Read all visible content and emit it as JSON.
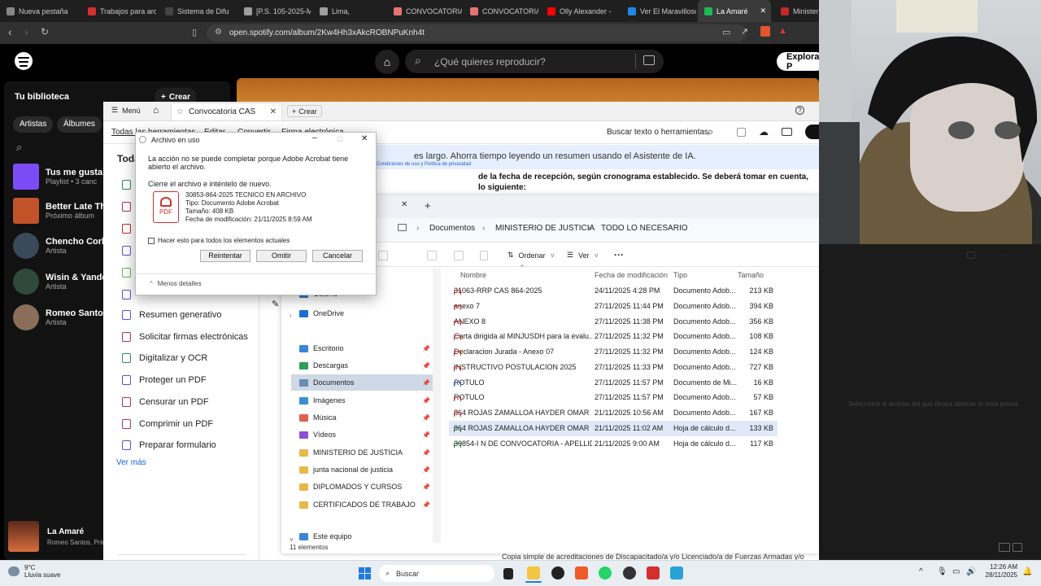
{
  "browser": {
    "tabs": [
      {
        "label": "Nueva pestaña",
        "color": "#888888"
      },
      {
        "label": "Trabajos para arc",
        "color": "#d32f2f"
      },
      {
        "label": "Sistema de Difu",
        "color": "#444444"
      },
      {
        "label": "[P.S. 105-2025-M",
        "color": "#9e9e9e"
      },
      {
        "label": "Lima,",
        "color": "#9e9e9e"
      },
      {
        "label": "CONVOCATORIA -",
        "color": "#e57373"
      },
      {
        "label": "CONVOCATORIA",
        "color": "#e57373"
      },
      {
        "label": "Olly Alexander -",
        "color": "#ff0000"
      },
      {
        "label": "Ver El Maravillosc",
        "color": "#1e88e5"
      },
      {
        "label": "La Amaré",
        "color": "#1db954",
        "active": true
      },
      {
        "label": "Ministeri",
        "color": "#c62828"
      }
    ],
    "url": "open.spotify.com/album/2Kw4Hh3xAkcROBNPuKnh4t"
  },
  "spotify": {
    "search_placeholder": "¿Qué quieres reproducir?",
    "explore_label": "Explorar P",
    "library_title": "Tu biblioteca",
    "create_label": "Crear",
    "filters": [
      "Artistas",
      "Álbumes"
    ],
    "items": [
      {
        "title": "Tus me gusta",
        "sub": "Playlist • 3 canc",
        "color": "#7b4cf5"
      },
      {
        "title": "Better Late Tha",
        "sub": "Próximo álbum",
        "color": "#c2522a"
      },
      {
        "title": "Chencho Corle",
        "sub": "Artista",
        "color": "#3b4a5a"
      },
      {
        "title": "Wisin & Yandel",
        "sub": "Artista",
        "color": "#2f4a3a"
      },
      {
        "title": "Romeo Santos",
        "sub": "Artista",
        "color": "#8a6e5a"
      }
    ],
    "now_playing": {
      "title": "La Amaré",
      "artist": "Romeo Santos, Prin"
    }
  },
  "acrobat": {
    "menu_label": "Menú",
    "tab_title": "Convocatoria CAS",
    "create_label": "Crear",
    "toolbar_tabs": [
      "Todas las herramientas",
      "Editar",
      "Convertir",
      "Firma electrónica"
    ],
    "search_tools": "Buscar texto o herramientas",
    "left_heading": "Toda",
    "tools": [
      "Resumen generativo",
      "Solicitar firmas electrónicas",
      "Digitalizar y OCR",
      "Proteger un PDF",
      "Censurar un PDF",
      "Comprimir un PDF",
      "Preparar formulario"
    ],
    "more_label": "Ver más",
    "ai_banner": "es largo. Ahorra tiempo leyendo un resumen usando el Asistente de IA.",
    "ai_links": "Condiciones de uso  y  Política de privacidad",
    "doc_text": "de la fecha de recepción, según cronograma establecido. Se deberá tomar en cuenta, lo siguiente:",
    "doc_bottom": "Copia simple de acreditaciones de Discapacitado/a y/o Licenciado/a de Fuerzas Armadas y/o"
  },
  "explorer": {
    "breadcrumb": [
      "Documentos",
      "MINISTERIO DE JUSTICIA",
      "TODO LO NECESARIO"
    ],
    "cmd": {
      "sort": "Ordenar",
      "view": "Ver",
      "preview": "Vista previa"
    },
    "nav": [
      {
        "label": "Galería",
        "color": "#2b7fd9",
        "pin": false
      },
      {
        "label": "OneDrive",
        "color": "#1e6fd1",
        "pin": false
      },
      {
        "label": "Escritorio",
        "color": "#3a86d4",
        "pin": true
      },
      {
        "label": "Descargas",
        "color": "#2e9e5b",
        "pin": true
      },
      {
        "label": "Documentos",
        "color": "#6a8caf",
        "pin": true,
        "selected": true
      },
      {
        "label": "Imágenes",
        "color": "#3b8fd6",
        "pin": true
      },
      {
        "label": "Música",
        "color": "#e0604f",
        "pin": true
      },
      {
        "label": "Vídeos",
        "color": "#8c4fd6",
        "pin": true
      },
      {
        "label": "MINISTERIO DE JUSTICIA",
        "color": "#e8b84a",
        "pin": true
      },
      {
        "label": "junta nacional de justicia",
        "color": "#e8b84a",
        "pin": true
      },
      {
        "label": "DIPLOMADOS Y CURSOS",
        "color": "#e8b84a",
        "pin": true
      },
      {
        "label": "CERTIFICADOS DE TRABAJO",
        "color": "#e8b84a",
        "pin": true
      },
      {
        "label": "Este equipo",
        "color": "#3a86d4",
        "pin": false
      }
    ],
    "columns": [
      "Nombre",
      "Fecha de modificación",
      "Tipo",
      "Tamaño"
    ],
    "files": [
      {
        "name": "31063-RRP CAS 864-2025",
        "date": "24/11/2025 4:28 PM",
        "type": "Documento Adob...",
        "size": "213 KB",
        "kind": "pdf"
      },
      {
        "name": "anexo 7",
        "date": "27/11/2025 11:44 PM",
        "type": "Documento Adob...",
        "size": "394 KB",
        "kind": "pdf"
      },
      {
        "name": "ANEXO 8",
        "date": "27/11/2025 11:38 PM",
        "type": "Documento Adob...",
        "size": "356 KB",
        "kind": "pdf"
      },
      {
        "name": "Carta dirigida al MINJUSDH para la evalu...",
        "date": "27/11/2025 11:32 PM",
        "type": "Documento Adob...",
        "size": "108 KB",
        "kind": "pdf"
      },
      {
        "name": "Declaracion Jurada - Anexo 07",
        "date": "27/11/2025 11:32 PM",
        "type": "Documento Adob...",
        "size": "124 KB",
        "kind": "pdf"
      },
      {
        "name": "INSTRUCTIVO POSTULACION 2025",
        "date": "27/11/2025 11:33 PM",
        "type": "Documento Adob...",
        "size": "727 KB",
        "kind": "pdf"
      },
      {
        "name": "ROTULO",
        "date": "27/11/2025 11:57 PM",
        "type": "Documento de Mi...",
        "size": "16 KB",
        "kind": "doc"
      },
      {
        "name": "ROTULO",
        "date": "27/11/2025 11:57 PM",
        "type": "Documento Adob...",
        "size": "57 KB",
        "kind": "pdf"
      },
      {
        "name": "864 ROJAS ZAMALLOA HAYDER OMAR",
        "date": "21/11/2025 10:56 AM",
        "type": "Documento Adob...",
        "size": "167 KB",
        "kind": "pdf"
      },
      {
        "name": "864 ROJAS ZAMALLOA HAYDER OMAR",
        "date": "21/11/2025 11:02 AM",
        "type": "Hoja de cálculo d...",
        "size": "133 KB",
        "kind": "xls",
        "selected": true
      },
      {
        "name": "30854-I N DE CONVOCATORIA - APELLID...",
        "date": "21/11/2025 9:00 AM",
        "type": "Hoja de cálculo d...",
        "size": "117 KB",
        "kind": "xls"
      }
    ],
    "preview_hint": "Seleccione el archivo del que desea obtener la vista previa.",
    "status": "11 elementos"
  },
  "dialog": {
    "title": "Archivo en uso",
    "message": "La acción no se puede completar porque Adobe Acrobat  tiene abierto el archivo.",
    "hint": "Cierre el archivo e inténtelo de nuevo.",
    "file_name": "30853-864-2025 TECNICO EN ARCHIVO",
    "file_type": "Tipo: Documento Adobe Acrobat",
    "file_size": "Tamaño: 408 KB",
    "file_date": "Fecha de modificación: 21/11/2025 8:59 AM",
    "checkbox": "Hacer esto para todos los elementos actuales",
    "buttons": [
      "Reintentar",
      "Omitir",
      "Cancelar"
    ],
    "less_details": "Menos detalles",
    "pdf_label": "PDF"
  },
  "taskbar": {
    "weather_temp": "9°C",
    "weather_desc": "Lluvia suave",
    "search": "Buscar",
    "time": "12:26 AM",
    "date": "28/11/2025"
  }
}
